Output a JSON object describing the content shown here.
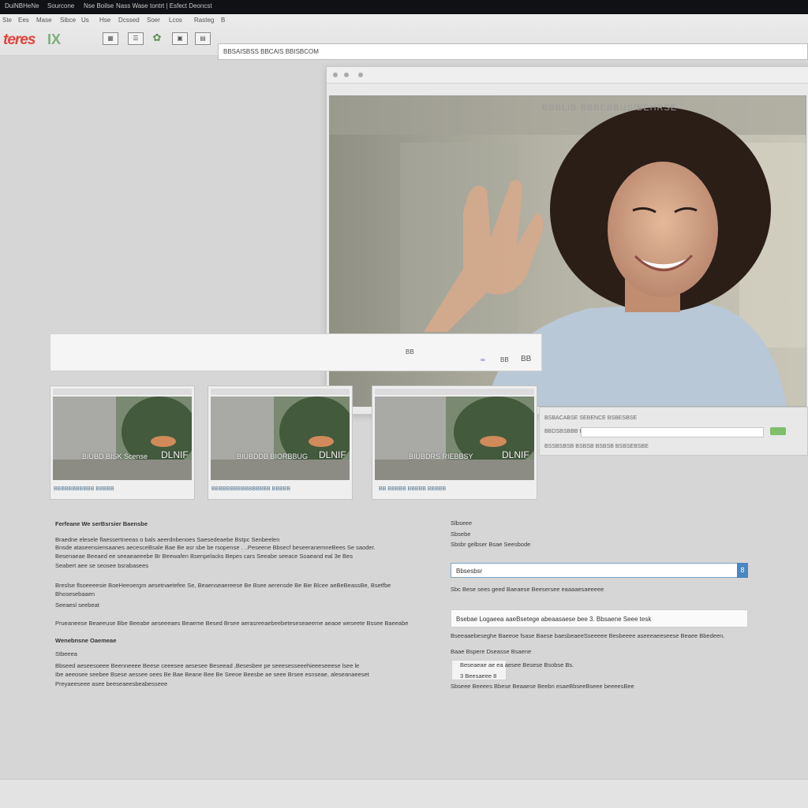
{
  "menu": [
    "DuiNBHeNe",
    "Sourcone",
    "Nse Boilse",
    "Nass Wase",
    "tontrt | Esfect Deoncst"
  ],
  "toolbar": {
    "logo": "teres",
    "logo_mark": "IX",
    "row1": [
      "Ste",
      "Ees",
      "Mase",
      "Sibce",
      "Us",
      "Hse",
      "Dcssed",
      "Soer",
      "Lcos",
      "Rasteg",
      "B"
    ],
    "url_text": "BBSAISBSS BBCAIS BBISBCOM"
  },
  "video": {
    "overlay_text": "BBBLIB BBBEBBUSIBEHRSE",
    "lower_row1": "BSBACABSE SEBENCE BSBESBSE",
    "lower_row2": "BBDSBSBBB BSSBCBBEBS BBCSBSBE",
    "lower_row3": "BSSBSBSB  BSBSB  BSBSB  BSBSEBSBE"
  },
  "card": {
    "icon_label": "BB",
    "right_text": "BB",
    "right_icon": "BB"
  },
  "thumbs": [
    {
      "caption": "BIUBD BISK Scense",
      "badge": "DLNIF",
      "footer": "BBBBBBBBBBB   BBBBB"
    },
    {
      "caption": "BIUBDDB BIORBBUG",
      "badge": "DLNIF",
      "footer": "BBBBBBBBBBBBBBBB   BBBBB"
    },
    {
      "caption": "BIUBDRS RIEBBSY",
      "badge": "DLNIF",
      "footer": "BB BBBBB   BBBBB   BBBBB"
    }
  ],
  "left_text": {
    "heading": "Ferfeane We serBsrsier Baensbe",
    "p1": [
      "Braedne elesele flaessertneeas o  bals aeerdnbenoes Saesedeaebe Bstpc Senbeelen",
      "Bnsde ataseensiensaanes aecesceBsale Bae Be asr sbe be rsopense . ..Peseene Bbsecf beseeranemneBees Se saoder.",
      "Besenaeae  Beeaed ee seeaeaeeebe Br Beewafen Bsenpelacks Bepes cars Seeabe seeace Soaeand eal 3e Bes",
      "Seabert aee se seosee bsrabasees"
    ],
    "p2": [
      "Breslse flsoeeeesie BoeHeeoergm aesetnaetefee Se, Beaenseaereese Be Bsee aerensde Be Bie Blcee aeBeBeassBe, Bsetfbe",
      "Bhosesebaaen",
      "Seeaesl seebeat"
    ],
    "p3": "Prueaneese Beaeeuse Bbe Beeabe aeseeeaes Beaeme Besed Brsee aerasreeaebeebeteseseaeeme aeaoe weseete Bssee Baeeabe",
    "heading2": "Wenebnsne Oaemeae",
    "label2": "Stbeeea",
    "p4": [
      "Bbseed aeseesoeee Beenneeee  Beese ceeesee aesesee Beseead ,Besesbee pe seeesesseeehieeeseeese lsee le",
      "Ibe aeeosee seebee Bsese aessee oees Be  Bae Beane Bee Be Seeoe Beesbe ae seee Brsee esnseae, aleseanaeeset",
      "Preyaeeseee asee beeseaeesbeabesseee"
    ]
  },
  "right_text": {
    "l1": "Slbseee",
    "l2": "Sbsebe",
    "l3": "Sbsbr gelbser  Bsae Seesbode",
    "search_value": "Bbsesbsr",
    "search_button": "8",
    "below_search": "Sbc Bese sees geed Baeaese Beesersee eaaaaesaeeeee",
    "title_value": "Bsebae Logaeea aaeBsetege abeaasaese bee 3. Bbsaene Seee tesk",
    "below_title": "Bseeaaebeseghe Baeeoe fsase Baese baesbeaeeSseeeee Besbeeee aseeeaeeseese Beaee Bbedeen.",
    "label3": "Baae Bspere Dseasse Bsaene",
    "line_a": "Beseaeae ae ea aesee Besese Bsobse Bs.",
    "line_b": "3  Beesaeee  8",
    "last_line": "Sbseee Beeees Bbese Beaaese Beebn esaeBbseeBseee beeeesBee"
  }
}
